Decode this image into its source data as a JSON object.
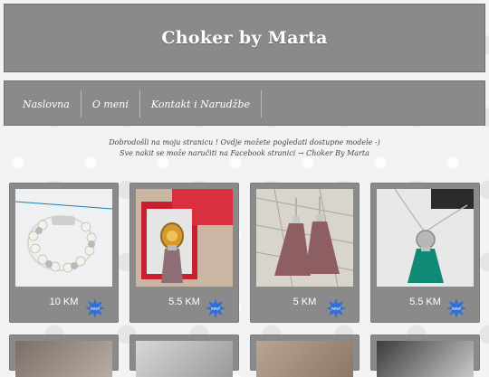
{
  "site": {
    "title": "Choker by Marta"
  },
  "nav": [
    {
      "label": "Naslovna"
    },
    {
      "label": "O meni"
    },
    {
      "label": "Kontakt i Narudžbe"
    }
  ],
  "intro": {
    "line1": "Dobrodošli na moju stranicu ! Ovdje možete pogledati dostupne modele -)",
    "line2": "Sve nakit se može naručiti na Facebook stranici → Choker By Marta"
  },
  "products": [
    {
      "price": "10 KM",
      "badge": "new!",
      "icon": "bracelet-photo"
    },
    {
      "price": "5.5 KM",
      "badge": "new!",
      "icon": "tassel-pendant-photo"
    },
    {
      "price": "5 KM",
      "badge": "new!",
      "icon": "tassel-earrings-photo"
    },
    {
      "price": "5.5 KM",
      "badge": "new!",
      "icon": "green-tassel-necklace-photo"
    }
  ],
  "colors": {
    "panel": "#8a8a8a",
    "badge": "#2e6fd8"
  }
}
